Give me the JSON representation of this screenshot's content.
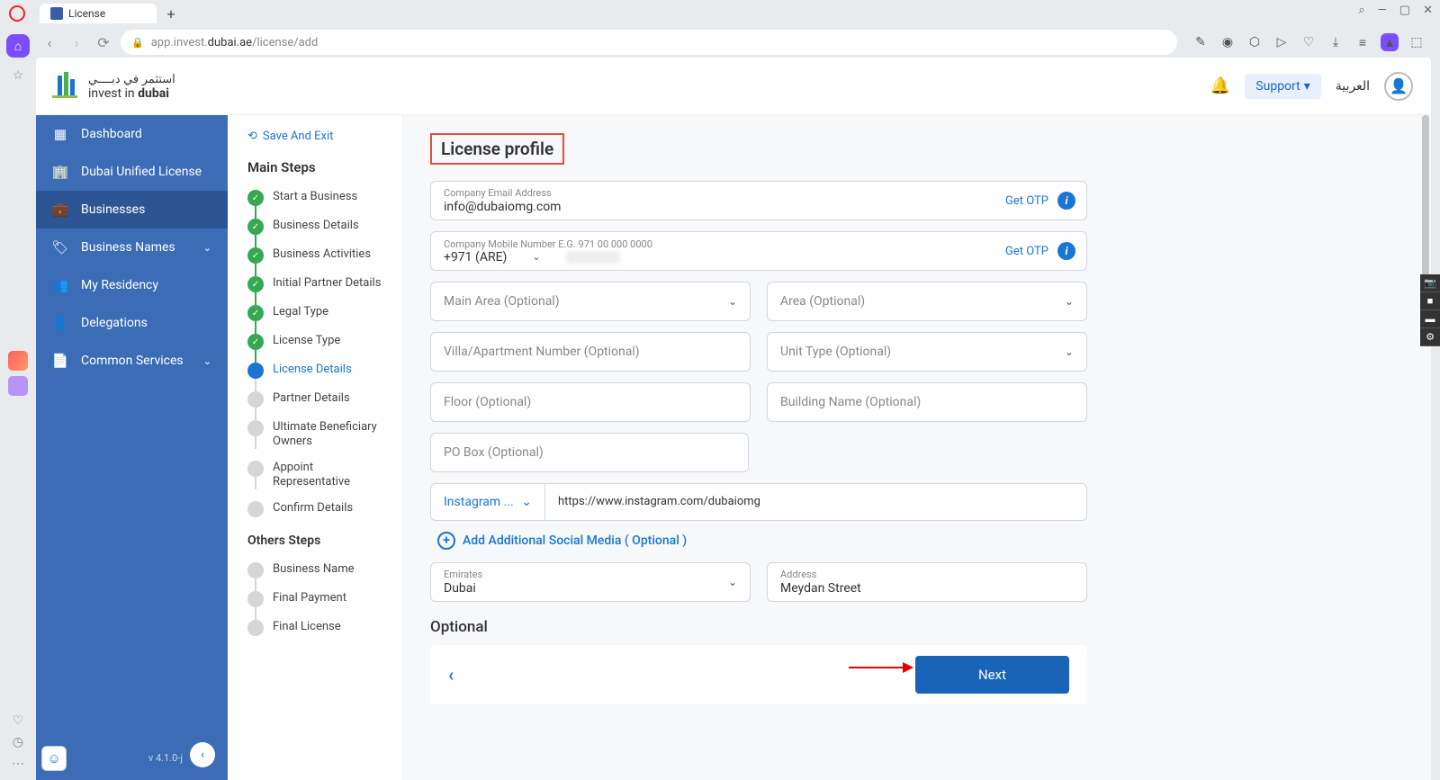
{
  "browser": {
    "tab_title": "License",
    "url_prefix": "app.invest.",
    "url_domain": "dubai.ae",
    "url_path": "/license/add"
  },
  "header": {
    "logo_ar": "استثمر في دبــــي",
    "logo_en_1": "invest in ",
    "logo_en_2": "dubai",
    "support": "Support",
    "lang": "العربية"
  },
  "nav": {
    "items": [
      {
        "label": "Dashboard"
      },
      {
        "label": "Dubai Unified License"
      },
      {
        "label": "Businesses"
      },
      {
        "label": "Business Names"
      },
      {
        "label": "My Residency"
      },
      {
        "label": "Delegations"
      },
      {
        "label": "Common Services"
      }
    ],
    "version": "v 4.1.0-j"
  },
  "steps": {
    "save_exit": "Save And Exit",
    "main_heading": "Main Steps",
    "others_heading": "Others Steps",
    "main": [
      {
        "label": "Start a Business",
        "state": "done"
      },
      {
        "label": "Business Details",
        "state": "done"
      },
      {
        "label": "Business Activities",
        "state": "done"
      },
      {
        "label": "Initial Partner Details",
        "state": "done"
      },
      {
        "label": "Legal Type",
        "state": "done"
      },
      {
        "label": "License Type",
        "state": "done"
      },
      {
        "label": "License Details",
        "state": "active"
      },
      {
        "label": "Partner Details",
        "state": "pending"
      },
      {
        "label": "Ultimate Beneficiary Owners",
        "state": "pending"
      },
      {
        "label": "Appoint Representative",
        "state": "pending"
      },
      {
        "label": "Confirm Details",
        "state": "pending"
      }
    ],
    "others": [
      {
        "label": "Business Name"
      },
      {
        "label": "Final Payment"
      },
      {
        "label": "Final License"
      }
    ]
  },
  "form": {
    "title": "License profile",
    "email_label": "Company Email Address",
    "email_value": "info@dubaiomg.com",
    "mobile_label": "Company Mobile Number E.G. 971 00 000 0000",
    "mobile_code": "+971 (ARE)",
    "get_otp": "Get OTP",
    "main_area": "Main Area (Optional)",
    "area": "Area (Optional)",
    "villa": "Villa/Apartment Number (Optional)",
    "unit_type": "Unit Type (Optional)",
    "floor": "Floor (Optional)",
    "building": "Building Name (Optional)",
    "pobox": "PO Box (Optional)",
    "social_platform": "Instagram ...",
    "social_url": "https://www.instagram.com/dubaiomg",
    "add_social": "Add Additional Social Media ( Optional )",
    "emirates_label": "Emirates",
    "emirates_value": "Dubai",
    "address_label": "Address",
    "address_value": "Meydan Street",
    "optional_heading": "Optional",
    "next": "Next"
  }
}
